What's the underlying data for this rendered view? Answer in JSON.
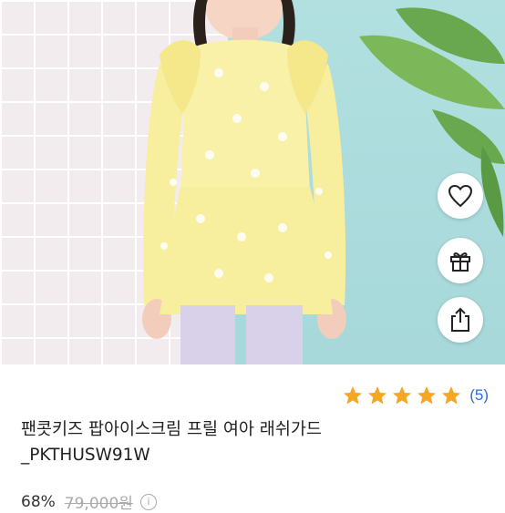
{
  "product": {
    "image_alt": "팬콧키즈 팝아이스크림 프릴 여아 래쉬가드",
    "title_line1": "팬콧키즈 팝아이스크림 프릴 여아 래쉬가드",
    "title_line2": "_PKTHUSW91W",
    "rating": {
      "stars": 5,
      "count_text": "(5)"
    },
    "price": {
      "discount": "68%",
      "original": "79,000원",
      "info_icon": "i"
    }
  },
  "actions": [
    {
      "name": "heart-icon"
    },
    {
      "name": "gift-icon"
    },
    {
      "name": "share-icon"
    }
  ],
  "colors": {
    "star": "#f5a623",
    "accent_link": "#2f6dd6",
    "shirt": "#f7ee9e"
  }
}
